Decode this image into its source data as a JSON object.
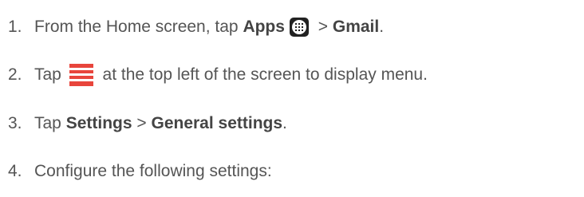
{
  "steps": [
    {
      "num": "1.",
      "pre": "From the Home screen, tap ",
      "apps": "Apps",
      "sep": " > ",
      "gmail": "Gmail",
      "end": "."
    },
    {
      "num": "2.",
      "pre": "Tap ",
      "post": " at the top left of the screen to display menu."
    },
    {
      "num": "3.",
      "pre": "Tap ",
      "settings": "Settings",
      "sep": " > ",
      "general": "General settings",
      "end": "."
    },
    {
      "num": "4.",
      "text": "Configure the following settings:"
    }
  ],
  "icons": {
    "apps": "apps-grid-icon",
    "menu": "menu-hamburger-icon",
    "menu_color": "#e8453c"
  }
}
